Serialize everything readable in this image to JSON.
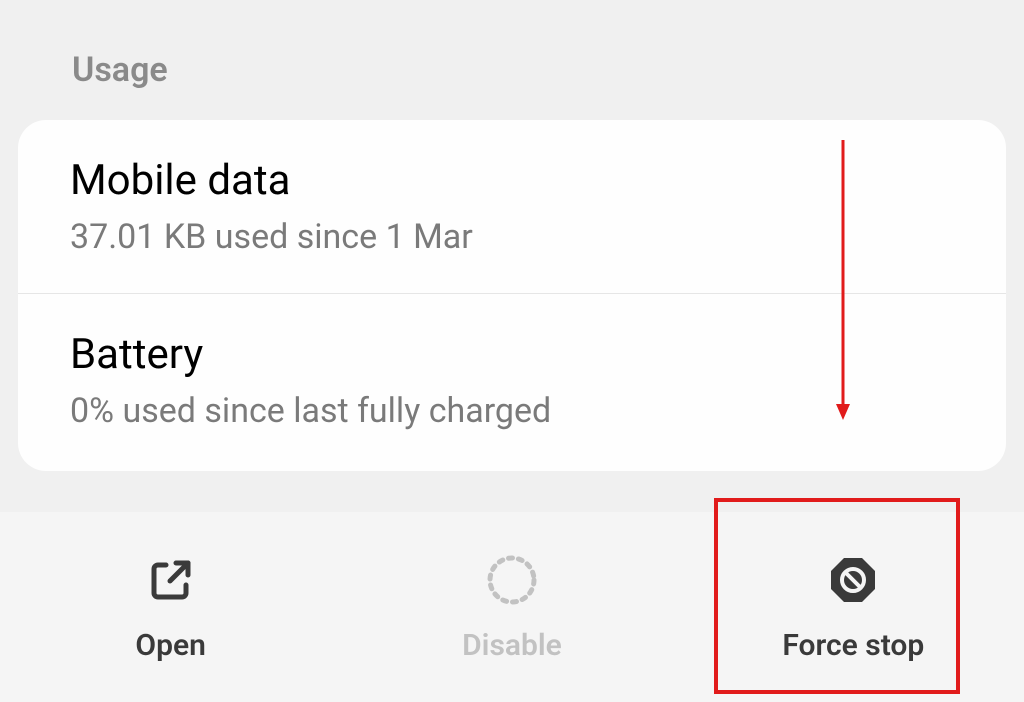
{
  "section_label": "Usage",
  "items": [
    {
      "title": "Mobile data",
      "sub": "37.01 KB used since 1 Mar"
    },
    {
      "title": "Battery",
      "sub": "0% used since last fully charged"
    }
  ],
  "actions": {
    "open": "Open",
    "disable": "Disable",
    "force_stop": "Force stop"
  },
  "annotation": {
    "arrow_color": "#e11b1b",
    "highlight_color": "#e11b1b"
  }
}
